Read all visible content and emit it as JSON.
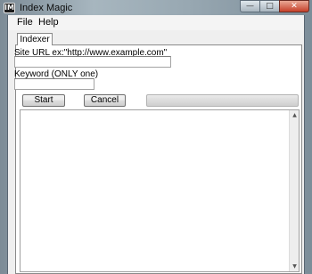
{
  "window": {
    "title": "Index Magic",
    "app_icon_glyph": "IM",
    "caption_buttons": {
      "minimize_glyph": "—",
      "maximize_glyph": "□",
      "close_glyph": "✕"
    }
  },
  "menu": {
    "items": [
      {
        "label": "File"
      },
      {
        "label": "Help"
      }
    ]
  },
  "tabs": [
    {
      "label": "Indexer",
      "active": true
    }
  ],
  "indexer": {
    "site_url_label": "Site URL ex:\"http://www.example.com\"",
    "site_url_value": "",
    "keyword_label": "Keyword (ONLY one)",
    "keyword_value": "",
    "start_label": "Start",
    "cancel_label": "Cancel",
    "progress": 0,
    "log_text": "",
    "scroll_up_glyph": "▲",
    "scroll_down_glyph": "▼"
  }
}
